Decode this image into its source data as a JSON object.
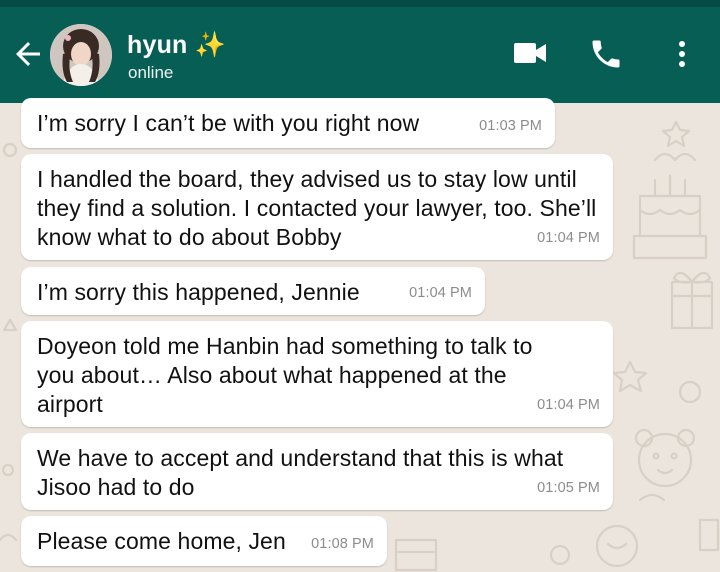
{
  "header": {
    "contact_name": "hyun",
    "name_emoji": "✨",
    "status": "online"
  },
  "messages": [
    {
      "text": "I’m sorry I can’t be with you right now",
      "time": "01:03 PM"
    },
    {
      "text": "I handled the board, they advised us to stay low until they find a solution. I contacted your lawyer, too. She’ll know what to do about Bobby",
      "time": "01:04 PM"
    },
    {
      "text": "I’m sorry this happened, Jennie",
      "time": "01:04 PM"
    },
    {
      "text": "Doyeon told me Hanbin had something to talk to you about… Also about what happened at the airport",
      "time": "01:04 PM"
    },
    {
      "text": "We have to accept and understand that this is what Jisoo had to do",
      "time": "01:05 PM"
    },
    {
      "text": "Please come home, Jen",
      "time": "01:08 PM"
    }
  ],
  "colors": {
    "header": "#075e54",
    "background": "#ece5dd",
    "bubble": "#ffffff",
    "timestamp": "#8c8c8c"
  },
  "icons": [
    "back-arrow-icon",
    "video-call-icon",
    "phone-icon",
    "more-options-icon"
  ]
}
